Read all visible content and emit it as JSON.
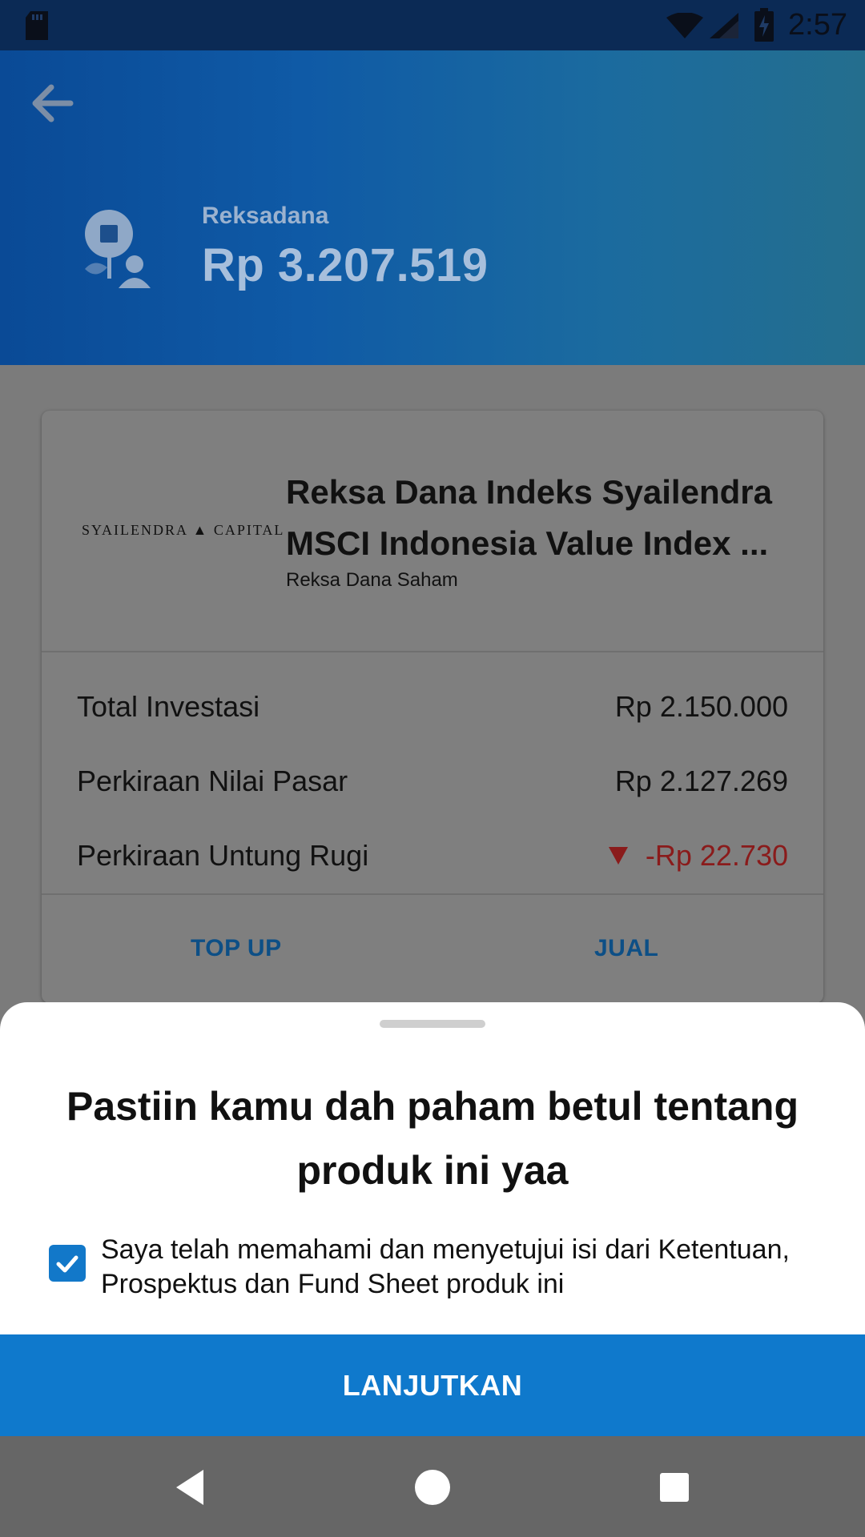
{
  "status_bar": {
    "time": "2:57",
    "icons": [
      "sd-card-icon",
      "wifi-icon",
      "signal-icon",
      "battery-icon"
    ]
  },
  "header": {
    "back_icon": "arrow-left-icon",
    "category": "Reksadana",
    "total_value": "Rp 3.207.519"
  },
  "card": {
    "brand": {
      "left": "SYAILENDRA",
      "right": "CAPITAL"
    },
    "fund_name": "Reksa Dana Indeks Syailendra MSCI Indonesia Value Index ...",
    "fund_type": "Reksa Dana Saham",
    "rows": [
      {
        "label": "Total Investasi",
        "value": "Rp 2.150.000"
      },
      {
        "label": "Perkiraan Nilai Pasar",
        "value": "Rp 2.127.269"
      },
      {
        "label": "Perkiraan Untung Rugi",
        "value": "-Rp 22.730"
      }
    ],
    "actions": {
      "top_up": "TOP UP",
      "sell": "JUAL"
    }
  },
  "bottom_sheet": {
    "title": "Pastiin kamu dah paham betul tentang produk ini yaa",
    "checkbox_checked": true,
    "checkbox_text": "Saya telah memahami dan menyetujui isi dari Ketentuan, Prospektus dan Fund Sheet produk ini",
    "continue_label": "LANJUTKAN"
  },
  "nav_bar": {
    "buttons": [
      "back-icon",
      "home-icon",
      "recents-icon"
    ]
  },
  "colors": {
    "primary": "#0F79CC",
    "loss": "#8A1B1B",
    "header_start": "#0A4A96",
    "header_end": "#246E8E"
  }
}
